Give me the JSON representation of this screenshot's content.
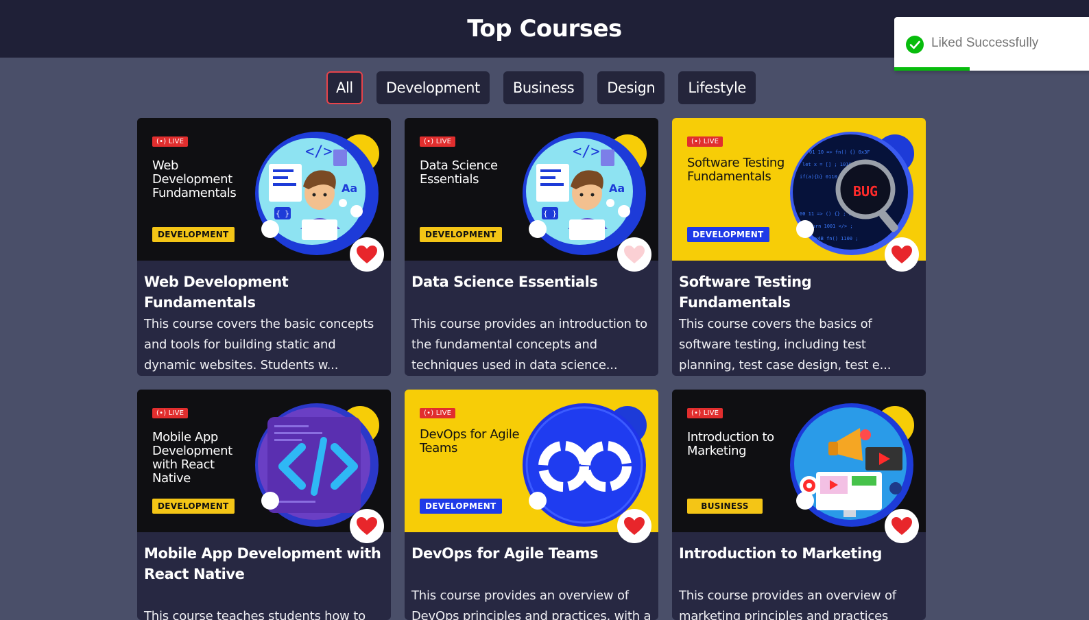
{
  "header": {
    "title": "Top Courses"
  },
  "filters": [
    {
      "label": "All",
      "active": true
    },
    {
      "label": "Development",
      "active": false
    },
    {
      "label": "Business",
      "active": false
    },
    {
      "label": "Design",
      "active": false
    },
    {
      "label": "Lifestyle",
      "active": false
    }
  ],
  "live_label": "LIVE",
  "courses": [
    {
      "thumb_title": "Web Development Fundamentals",
      "tag": "DEVELOPMENT",
      "title": "Web Development Fundamentals",
      "description": "This course covers the basic concepts and tools for building static and dynamic websites. Students w...",
      "liked": true,
      "theme": "dark",
      "art": "developer-laptop-illustration"
    },
    {
      "thumb_title": "Data Science Essentials",
      "tag": "DEVELOPMENT",
      "title": "Data Science Essentials",
      "description": "This course provides an introduction to the fundamental concepts and techniques used in data science...",
      "liked": false,
      "theme": "dark",
      "art": "developer-laptop-illustration"
    },
    {
      "thumb_title": "Software Testing Fundamentals",
      "tag": "DEVELOPMENT",
      "title": "Software Testing Fundamentals",
      "description": "This course covers the basics of software testing, including test planning, test case design, test e...",
      "liked": true,
      "theme": "yellow",
      "art": "bug-magnifier-illustration"
    },
    {
      "thumb_title": "Mobile App Development with React Native",
      "tag": "DEVELOPMENT",
      "title": "Mobile App Development with React Native",
      "description": "This course teaches students how to",
      "liked": true,
      "theme": "dark",
      "art": "code-brackets-illustration"
    },
    {
      "thumb_title": "DevOps for Agile Teams",
      "tag": "DEVELOPMENT",
      "title": "DevOps for Agile Teams",
      "description": "This course provides an overview of DevOps principles and practices, with a",
      "liked": true,
      "theme": "yellow",
      "art": "infinity-loop-illustration"
    },
    {
      "thumb_title": "Introduction to Marketing",
      "tag": "BUSINESS",
      "title": "Introduction to Marketing",
      "description": "This course provides an overview of marketing principles and practices",
      "liked": true,
      "theme": "dark",
      "art": "marketing-megaphone-illustration"
    }
  ],
  "toast": {
    "message": "Liked Successfully",
    "progress": 0.38
  },
  "colors": {
    "accent": "#e8434a",
    "heart_liked": "#e8262b",
    "heart_unliked": "#fbd0d4",
    "toast_success": "#07bc0c"
  }
}
